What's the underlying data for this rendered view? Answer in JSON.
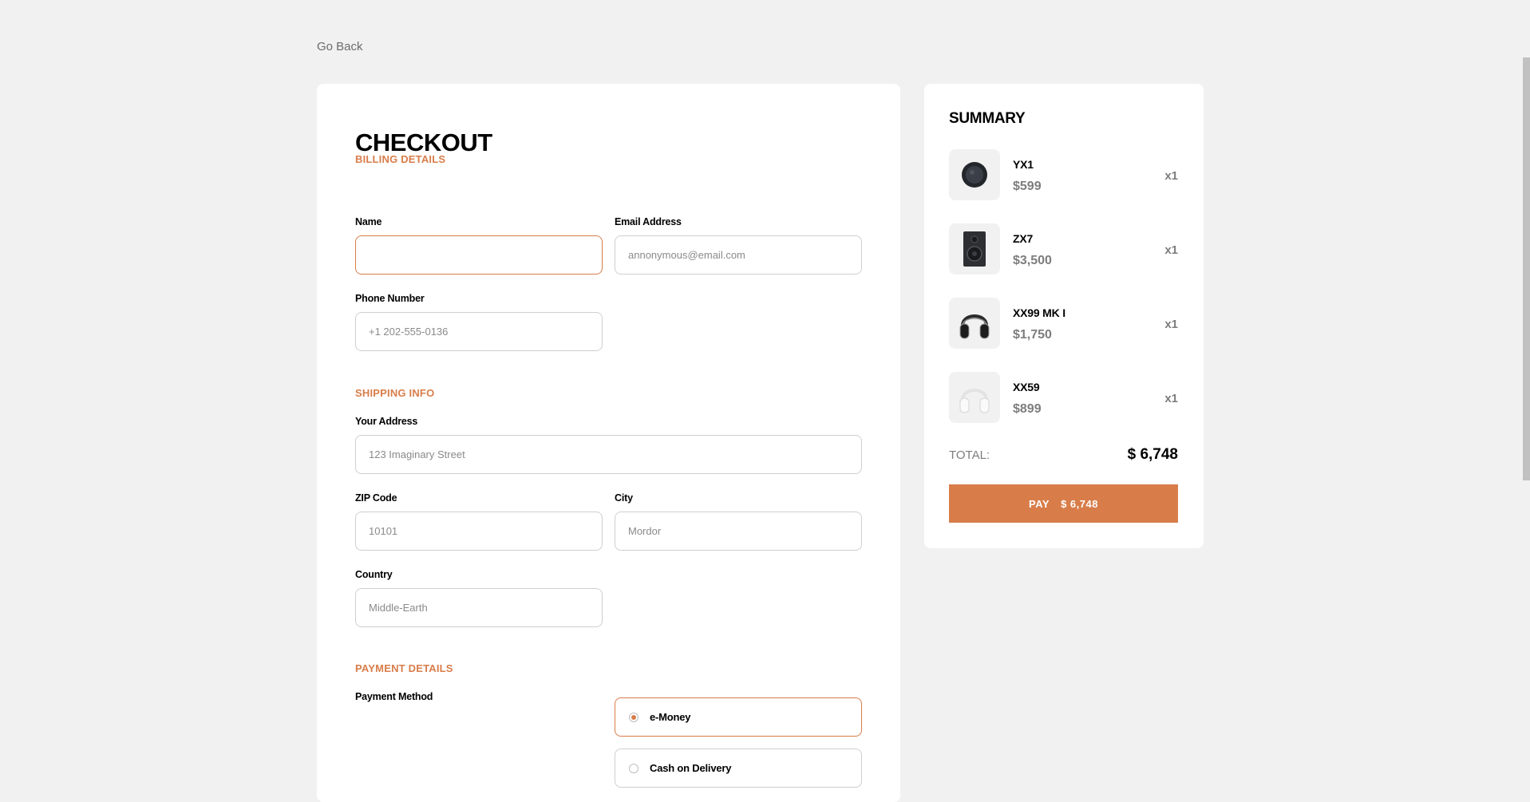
{
  "nav": {
    "go_back": "Go Back"
  },
  "checkout": {
    "title": "CHECKOUT",
    "billing": {
      "title": "BILLING DETAILS",
      "name_label": "Name",
      "name_value": "",
      "email_label": "Email Address",
      "email_placeholder": "annonymous@email.com",
      "phone_label": "Phone Number",
      "phone_placeholder": "+1 202-555-0136"
    },
    "shipping": {
      "title": "SHIPPING INFO",
      "address_label": "Your Address",
      "address_placeholder": "123 Imaginary Street",
      "zip_label": "ZIP Code",
      "zip_placeholder": "10101",
      "city_label": "City",
      "city_placeholder": "Mordor",
      "country_label": "Country",
      "country_placeholder": "Middle-Earth"
    },
    "payment": {
      "title": "PAYMENT DETAILS",
      "method_label": "Payment Method",
      "options": [
        {
          "label": "e-Money",
          "selected": true
        },
        {
          "label": "Cash on Delivery",
          "selected": false
        }
      ]
    }
  },
  "summary": {
    "title": "SUMMARY",
    "items": [
      {
        "name": "YX1",
        "price": "$599",
        "qty": "x1",
        "icon": "earphones-icon"
      },
      {
        "name": "ZX7",
        "price": "$3,500",
        "qty": "x1",
        "icon": "speaker-icon"
      },
      {
        "name": "XX99 MK I",
        "price": "$1,750",
        "qty": "x1",
        "icon": "headphones-dark-icon"
      },
      {
        "name": "XX59",
        "price": "$899",
        "qty": "x1",
        "icon": "headphones-white-icon"
      }
    ],
    "total_label": "TOTAL:",
    "total_value": "$ 6,748",
    "pay_label": "PAY",
    "pay_amount": "$ 6,748"
  },
  "colors": {
    "accent": "#d87d4a",
    "background": "#f1f1f1"
  }
}
